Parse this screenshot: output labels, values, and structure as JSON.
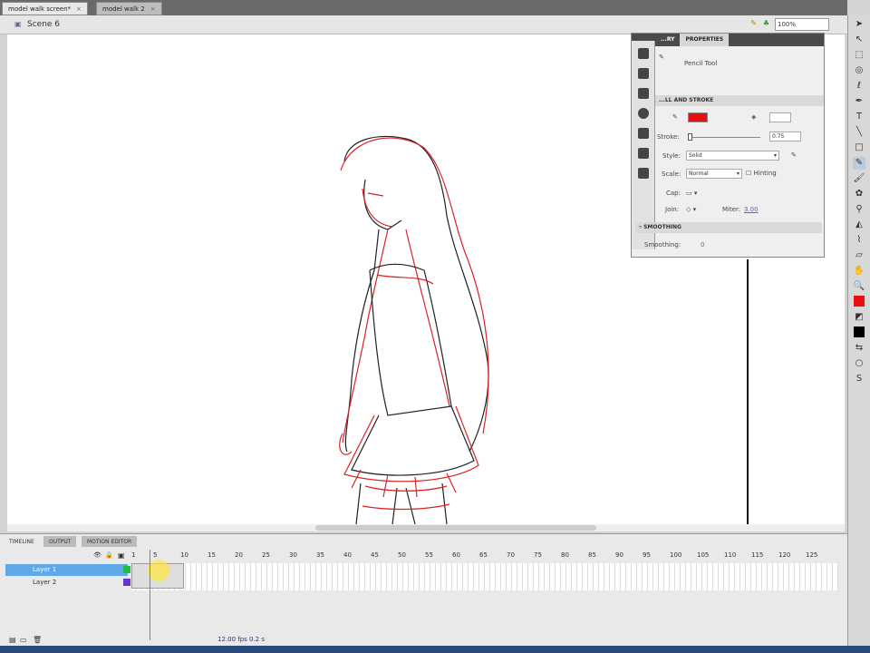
{
  "document_tabs": [
    {
      "label": "model walk screen*",
      "active": true
    },
    {
      "label": "model walk 2",
      "active": false
    }
  ],
  "scene": "Scene 6",
  "zoom": "100%",
  "properties": {
    "tabs": [
      "...RY",
      "PROPERTIES"
    ],
    "tool_name": "Pencil Tool",
    "fill_stroke_header": "...LL AND STROKE",
    "stroke_color": "#e81010",
    "stroke_label": "Stroke:",
    "stroke_value": "0.75",
    "style_label": "Style:",
    "style_value": "Solid",
    "scale_label": "Scale:",
    "scale_value": "Normal",
    "hinting_label": "Hinting",
    "cap_label": "Cap:",
    "join_label": "Join:",
    "miter_label": "Miter:",
    "miter_value": "3.00",
    "smoothing_header": "SMOOTHING",
    "smoothing_label": "Smoothing:",
    "smoothing_value": "0"
  },
  "timeline": {
    "tabs": [
      "TIMELINE",
      "OUTPUT",
      "MOTION EDITOR"
    ],
    "frame_numbers": [
      "1",
      "5",
      "10",
      "15",
      "20",
      "25",
      "30",
      "35",
      "40",
      "45",
      "50",
      "55",
      "60",
      "65",
      "70",
      "75",
      "80",
      "85",
      "90",
      "95",
      "100",
      "105",
      "110",
      "115",
      "120",
      "125"
    ],
    "layers": [
      {
        "name": "Layer 1",
        "selected": true,
        "color": "#22bb44"
      },
      {
        "name": "Layer 2",
        "selected": false,
        "color": "#6633cc"
      }
    ],
    "fps": "12.00 fps",
    "time": "0.2 s"
  }
}
